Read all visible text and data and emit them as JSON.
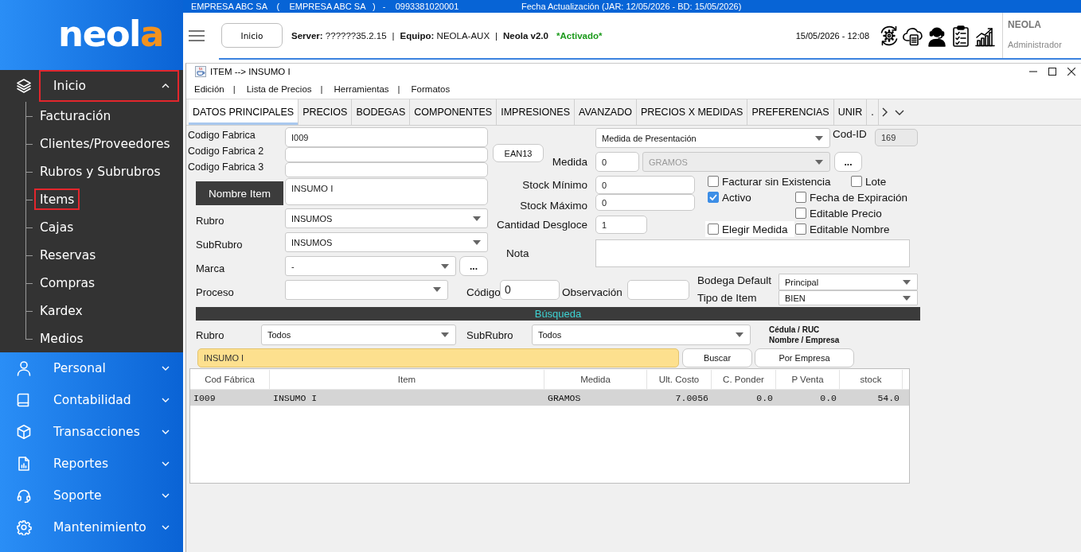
{
  "sidebar": {
    "logo": {
      "main": "neol",
      "accent": "a"
    },
    "items": [
      {
        "label": "Inicio",
        "selected": true,
        "expanded": true,
        "children": [
          {
            "label": "Facturación",
            "selected": false
          },
          {
            "label": "Clientes/Proveedores",
            "selected": false
          },
          {
            "label": "Rubros y Subrubros",
            "selected": false
          },
          {
            "label": "Items",
            "selected": true
          },
          {
            "label": "Cajas",
            "selected": false
          },
          {
            "label": "Reservas",
            "selected": false
          },
          {
            "label": "Compras",
            "selected": false
          },
          {
            "label": "Kardex",
            "selected": false
          },
          {
            "label": "Medios",
            "selected": false
          }
        ]
      },
      {
        "label": "Personal",
        "selected": false,
        "expanded": false
      },
      {
        "label": "Contabilidad",
        "selected": false,
        "expanded": false
      },
      {
        "label": "Transacciones",
        "selected": false,
        "expanded": false
      },
      {
        "label": "Reportes",
        "selected": false,
        "expanded": false
      },
      {
        "label": "Soporte",
        "selected": false,
        "expanded": false
      },
      {
        "label": "Mantenimiento",
        "selected": false,
        "expanded": false
      }
    ]
  },
  "top_strip": {
    "company": "EMPRESA ABC SA    (    EMPRESA ABC SA   )   -    0993381020001",
    "update_info": "Fecha Actualización (JAR: 12/05/2026 - BD: 15/05/2026)"
  },
  "header": {
    "home_button": "Inicio",
    "status": [
      {
        "kind": "info",
        "text": "**Server:** ??????35.2.15"
      },
      {
        "kind": "separator",
        "text": "|"
      },
      {
        "kind": "info",
        "text": "**Equipo:** NEOLA-AUX"
      },
      {
        "kind": "separator",
        "text": "|"
      },
      {
        "kind": "version",
        "text": "Neola v2.0"
      },
      {
        "kind": "status",
        "text": "*Activado*"
      }
    ],
    "datetime": "15/05/2026 - 12:08",
    "user": {
      "name": "NEOLA",
      "role": "Administrador"
    }
  },
  "window": {
    "title": "ITEM --> INSUMO I",
    "menu": [
      {
        "kind": "menu",
        "text": "Edición"
      },
      {
        "kind": "separator",
        "text": "|"
      },
      {
        "kind": "menu",
        "text": "Lista de Precios"
      },
      {
        "kind": "separator",
        "text": "|"
      },
      {
        "kind": "menu",
        "text": "Herramientas"
      },
      {
        "kind": "separator",
        "text": "|"
      },
      {
        "kind": "menu",
        "text": "Formatos"
      }
    ],
    "tabs": [
      {
        "label": "DATOS PRINCIPALES",
        "selected": true
      },
      {
        "label": "PRECIOS",
        "selected": false
      },
      {
        "label": "BODEGAS",
        "selected": false
      },
      {
        "label": "COMPONENTES",
        "selected": false
      },
      {
        "label": "IMPRESIONES",
        "selected": false
      },
      {
        "label": "AVANZADO",
        "selected": false
      },
      {
        "label": "PRECIOS X MEDIDAS",
        "selected": false
      },
      {
        "label": "PREFERENCIAS",
        "selected": false
      },
      {
        "label": "UNIR",
        "selected": false
      },
      {
        "label": ".",
        "selected": false
      }
    ],
    "form": {
      "codigo_fabrica": {
        "label": "Codigo Fabrica",
        "value": "I009"
      },
      "codigo_fabrica_2": {
        "label": "Codigo Fabrica 2"
      },
      "codigo_fabrica_3": {
        "label": "Codigo Fabrica 3"
      },
      "nombre_item": {
        "label": "Nombre Item",
        "value": "INSUMO I"
      },
      "rubro": {
        "label": "Rubro",
        "value": "INSUMOS"
      },
      "subrubro": {
        "label": "SubRubro",
        "value": "INSUMOS"
      },
      "marca": {
        "label": "Marca",
        "value": "-",
        "button": "..."
      },
      "proceso": {
        "label": "Proceso"
      },
      "medida_presentacion": {
        "value": "Medida de Presentación"
      },
      "cod_id": {
        "label": "Cod-ID",
        "value": "169",
        "disabled": true
      },
      "ean_button": "EAN13",
      "medida": {
        "label": "Medida",
        "value": "0",
        "unit": "GRAMOS",
        "unit_disabled": true,
        "button": "..."
      },
      "stock_minimo": {
        "label": "Stock Mínimo",
        "value": "0"
      },
      "stock_maximo": {
        "label": "Stock Máximo",
        "value": "0"
      },
      "cantidad_desgloce": {
        "label": "Cantidad Desgloce",
        "value": "1"
      },
      "checkboxes": [
        {
          "label": "Facturar sin Existencia",
          "checked": false,
          "focused": false
        },
        {
          "label": "Lote",
          "checked": false,
          "focused": false
        },
        {
          "label": "Activo",
          "checked": true,
          "focused": false
        },
        {
          "label": "Fecha de Expiración",
          "checked": false,
          "focused": false
        },
        {
          "label": "Editable Precio",
          "checked": false,
          "focused": false
        },
        {
          "label": "Elegir Medida",
          "checked": false,
          "focused": true
        },
        {
          "label": "Editable Nombre",
          "checked": false,
          "focused": false
        }
      ],
      "nota": {
        "label": "Nota"
      },
      "codigo": {
        "label": "Código",
        "value": "0"
      },
      "observacion": {
        "label": "Observación"
      },
      "bodega_default": {
        "label": "Bodega Default",
        "value": "Principal"
      },
      "tipo_item": {
        "label": "Tipo de Item",
        "value": "BIEN"
      }
    },
    "search": {
      "title": "Búsqueda",
      "rubro": {
        "label": "Rubro",
        "value": "Todos"
      },
      "subrubro": {
        "label": "SubRubro",
        "value": "Todos"
      },
      "options": [
        "Cédula / RUC",
        "Nombre / Empresa"
      ],
      "query": "INSUMO I",
      "buttons": [
        "Buscar",
        "Por Empresa"
      ]
    },
    "table": {
      "columns": [
        {
          "label": "Cod Fábrica",
          "kind": "text"
        },
        {
          "label": "Item",
          "kind": "text"
        },
        {
          "label": "Medida",
          "kind": "text"
        },
        {
          "label": "Ult. Costo",
          "kind": "number"
        },
        {
          "label": "C. Ponder",
          "kind": "number"
        },
        {
          "label": "P Venta",
          "kind": "number"
        },
        {
          "label": "stock",
          "kind": "number"
        }
      ],
      "rows": [
        {
          "selected": true,
          "cells": [
            "I009",
            "INSUMO I",
            "GRAMOS",
            "7.0056",
            "0.0",
            "0.0",
            "54.0"
          ]
        }
      ]
    }
  }
}
